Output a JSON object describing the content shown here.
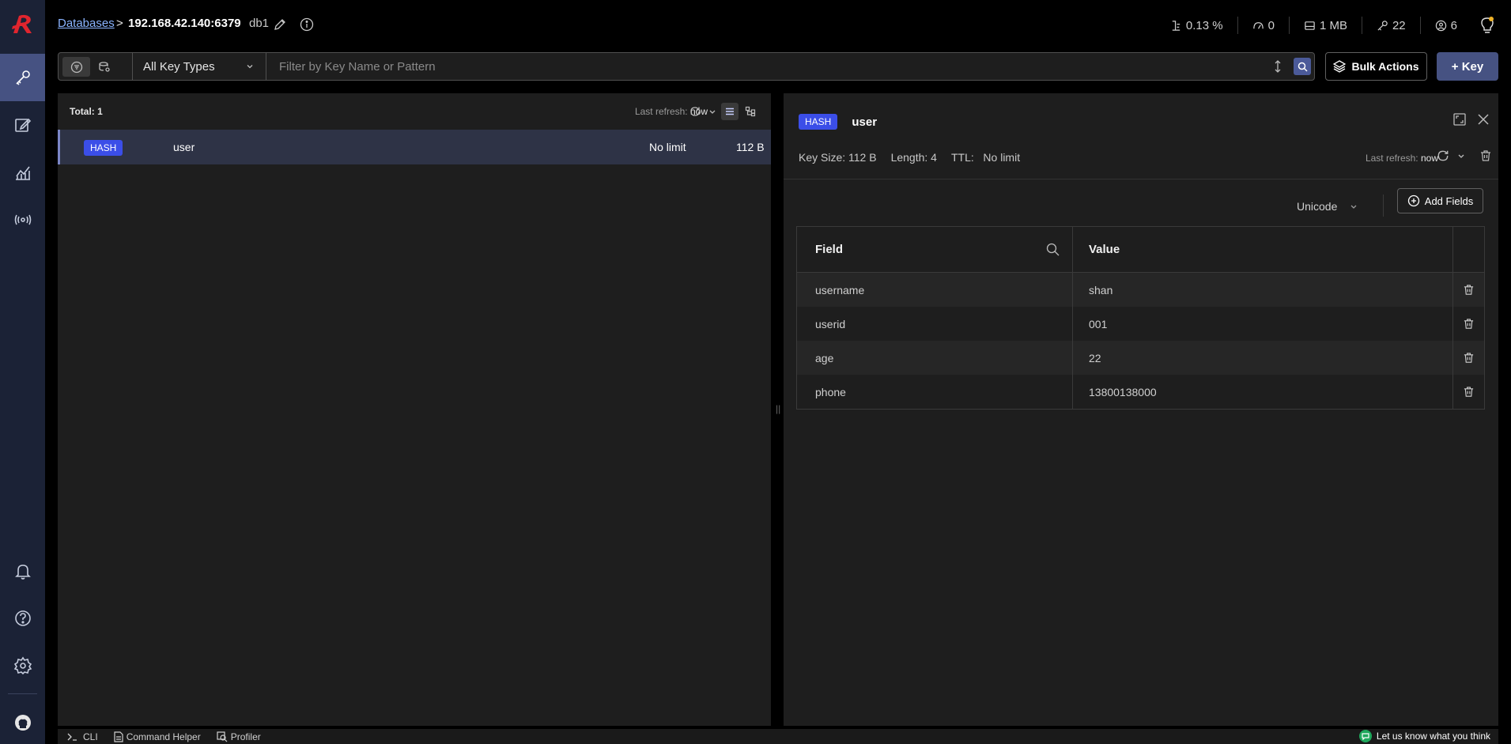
{
  "breadcrumb": {
    "databases": "Databases",
    "separator": ">",
    "host": "192.168.42.140:6379",
    "db_name": "db1"
  },
  "stats": {
    "cpu": "0.13 %",
    "ops": "0",
    "memory": "1 MB",
    "keys": "22",
    "clients": "6"
  },
  "filter": {
    "key_type": "All Key Types",
    "placeholder": "Filter by Key Name or Pattern",
    "bulk_actions": "Bulk Actions",
    "add_key": "+ Key"
  },
  "list": {
    "total": "Total: 1",
    "refresh_label": "Last refresh:",
    "refresh_value": "now",
    "rows": [
      {
        "type": "HASH",
        "name": "user",
        "ttl": "No limit",
        "size": "112 B"
      }
    ]
  },
  "details": {
    "type": "HASH",
    "key": "user",
    "key_size": "Key Size: 112 B",
    "length": "Length: 4",
    "ttl_label": "TTL:",
    "ttl_value": "No limit",
    "refresh_label": "Last refresh:",
    "refresh_value": "now",
    "format": "Unicode",
    "add_fields": "Add Fields",
    "columns": {
      "field": "Field",
      "value": "Value"
    },
    "rows": [
      {
        "field": "username",
        "value": "shan"
      },
      {
        "field": "userid",
        "value": "001"
      },
      {
        "field": "age",
        "value": "22"
      },
      {
        "field": "phone",
        "value": "13800138000"
      }
    ]
  },
  "bottom": {
    "cli": "CLI",
    "command_helper": "Command Helper",
    "profiler": "Profiler",
    "feedback": "Let us know what you think"
  },
  "colors": {
    "accent": "#465282",
    "badge": "#3b4ee8",
    "sidebar": "#1b2236"
  }
}
